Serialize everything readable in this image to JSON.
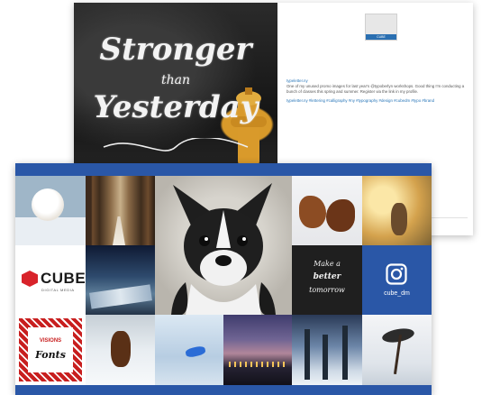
{
  "post": {
    "artwork_line1": "Stronger",
    "artwork_line2": "than",
    "artwork_line3": "Yesterday",
    "avatar_badge": "CUBE",
    "username": "typeletter.ny",
    "caption": "One of my unused promo images for last year's @typoberlyn workshops. Good thing I'm conducting a bunch of classes this spring and summer. Register via the link in my profile.",
    "hashtags": "typeletter.ny #lettering #calligraphy #ny #typography #design #cubedm #typo #brand"
  },
  "grid": {
    "brand_name": "CUBE",
    "brand_tagline": "DIGITAL MEDIA",
    "instagram_handle": "cube_dm",
    "script_line1": "Make a",
    "script_line2": "better",
    "script_line3": "tomorrow",
    "poster_line1": "VISIONS",
    "poster_line2": "Fonts"
  },
  "colors": {
    "brand_blue": "#2a57a7",
    "cube_red": "#d8232a",
    "link_blue": "#2a77b9"
  },
  "icons": {
    "instagram": "instagram-icon",
    "cube_mark": "cube-hexagon-icon"
  }
}
